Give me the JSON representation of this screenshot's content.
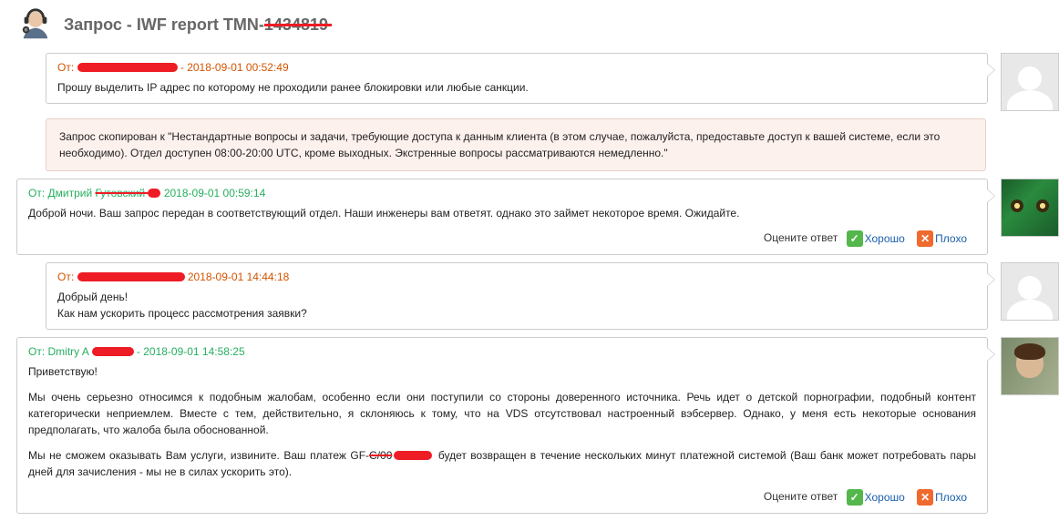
{
  "header": {
    "title_prefix": "Запрос - IWF report TMN-",
    "title_struck": "1434819"
  },
  "labels": {
    "from": "От:",
    "rate_answer": "Оцените ответ",
    "good": "Хорошо",
    "bad": "Плохо"
  },
  "messages": [
    {
      "kind": "client",
      "name_visible": "",
      "name_struck": true,
      "ts": "2018-09-01 00:52:49",
      "body": "Прошу выделить IP адрес по которому не проходили ранее блокировки или любые санкции.",
      "avatar": "anon"
    },
    {
      "kind": "system",
      "body": "Запрос скопирован к \"Нестандартные вопросы и задачи, требующие доступа к данным клиента (в этом случае, пожалуйста, предоставьте доступ к вашей системе, если это необходимо). Отдел доступен 08:00-20:00 UTC, кроме выходных. Экстренные вопросы рассматриваются немедленно.\""
    },
    {
      "kind": "staff",
      "name_visible": "Дмитрий ",
      "name_struck_part": "Гутовский ",
      "ts": "2018-09-01 00:59:14",
      "body": "Доброй ночи. Ваш запрос передан в соответствующий отдел. Наши инженеры вам ответят. однако это займет некоторое время. Ожидайте.",
      "avatar": "frog",
      "rate": true
    },
    {
      "kind": "client",
      "name_visible": "",
      "name_struck": true,
      "ts": "2018-09-01 14:44:18",
      "body_lines": [
        "Добрый день!",
        "Как нам ускорить процесс рассмотрения заявки?"
      ],
      "avatar": "anon"
    },
    {
      "kind": "staff",
      "name_visible": "Dmitry A",
      "name_redact_tail": true,
      "ts": "2018-09-01 14:58:25",
      "body_paras": [
        "Приветствую!",
        "Мы очень серьезно относимся к подобным жалобам, особенно если они поступили со стороны доверенного источника. Речь идет о детской порнографии, подобный контент категорически непри­емлем. Вместе с тем, действительно, я склоняюсь к тому, что на VDS отсутствовал настроенный вэбсервер. Однако, у меня есть некоторые основания предполагать, что жалоба была обоснован­ной.",
        "__PAYMENT__"
      ],
      "payment_prefix": "Мы не сможем оказывать Вам услуги, извините. Ваш платеж GF-",
      "payment_suffix": " будет возвращен в течение нескольких минут платежной системой (Ваш банк может потребовать пары дней для зачисле­ния - мы не в силах ускорить это).",
      "avatar": "person",
      "rate": true
    }
  ]
}
